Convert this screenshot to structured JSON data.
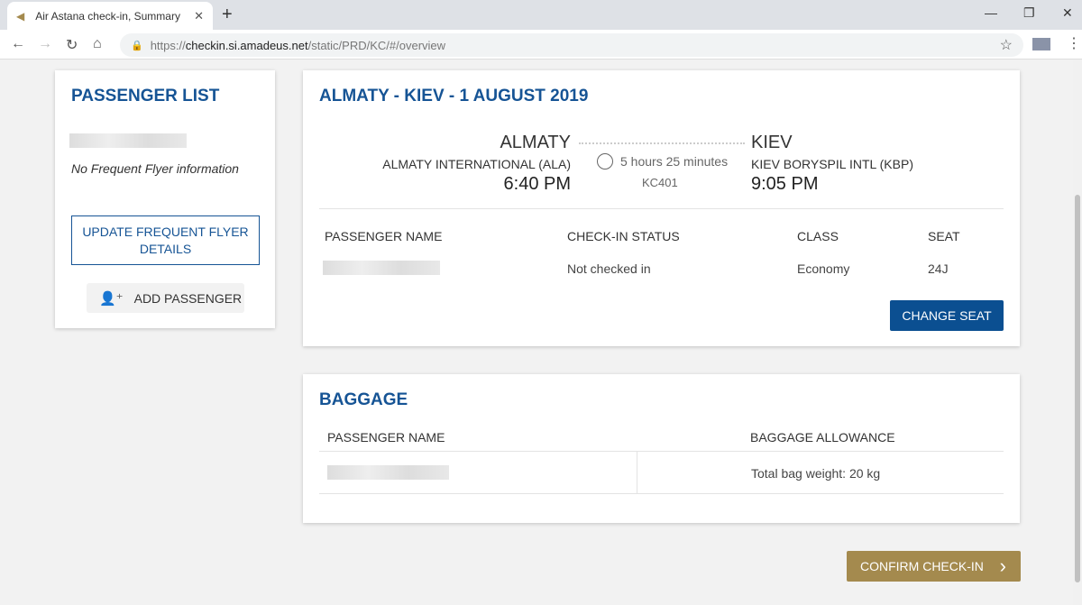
{
  "browser": {
    "tab_title": "Air Astana check-in, Summary",
    "url_scheme": "https://",
    "url_host": "checkin.si.amadeus.net",
    "url_path": "/static/PRD/KC/#/overview"
  },
  "passenger_list": {
    "title": "PASSENGER LIST",
    "ff_info": "No Frequent Flyer information",
    "update_button": "UPDATE FREQUENT FLYER DETAILS",
    "add_button": "ADD PASSENGER"
  },
  "flight": {
    "title": "ALMATY - KIEV - 1 AUGUST 2019",
    "origin_city": "ALMATY",
    "origin_airport": "ALMATY INTERNATIONAL (ALA)",
    "departure": "6:40 PM",
    "duration": "5 hours 25 minutes",
    "flight_no": "KC401",
    "dest_city": "KIEV",
    "dest_airport": "KIEV BORYSPIL INTL (KBP)",
    "arrival": "9:05 PM",
    "columns": [
      "PASSENGER NAME",
      "CHECK-IN STATUS",
      "CLASS",
      "SEAT"
    ],
    "row": {
      "status": "Not checked in",
      "class": "Economy",
      "seat": "24J"
    },
    "change_seat": "CHANGE SEAT"
  },
  "baggage": {
    "title": "BAGGAGE",
    "columns": [
      "PASSENGER NAME",
      "BAGGAGE ALLOWANCE"
    ],
    "allowance": "Total bag weight: 20 kg"
  },
  "confirm_button": "CONFIRM CHECK-IN"
}
